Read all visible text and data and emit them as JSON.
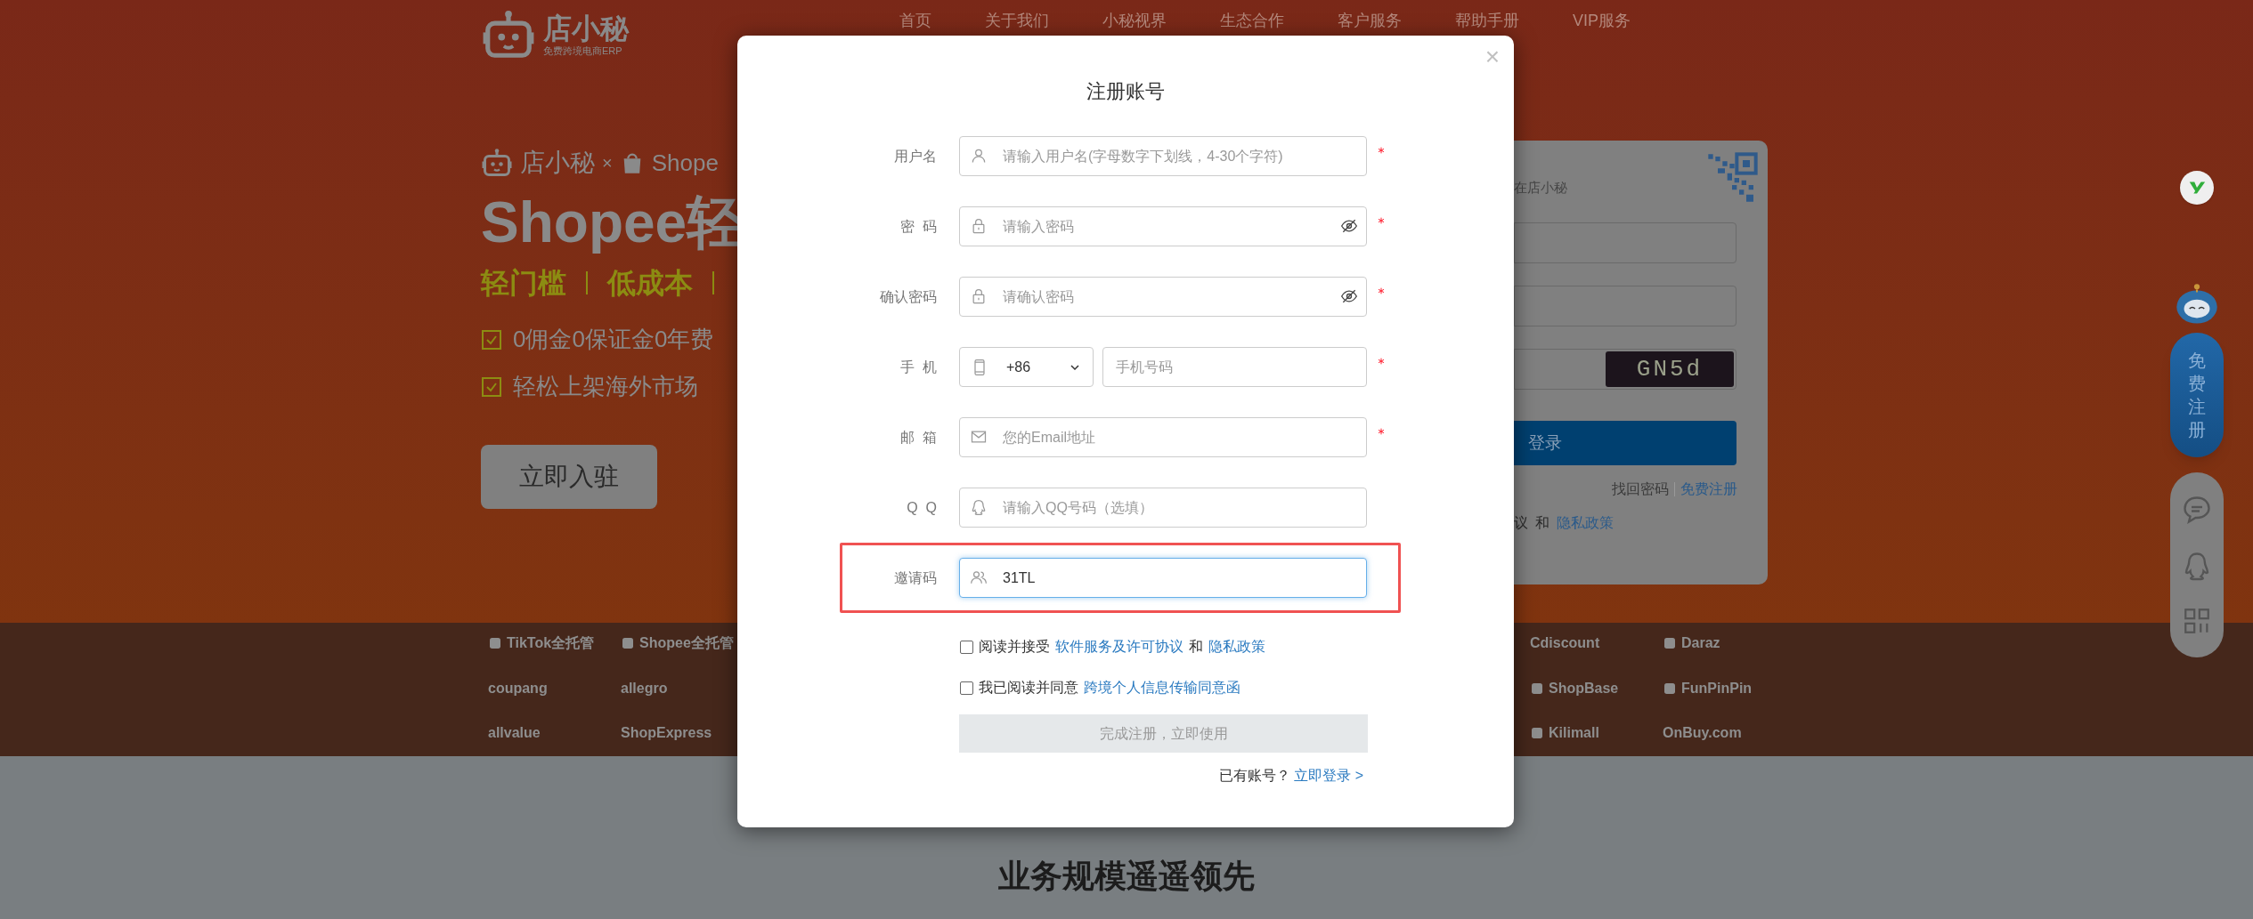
{
  "header": {
    "logo": {
      "name": "店小秘",
      "tagline": "免费跨境电商ERP"
    },
    "nav": [
      {
        "label": "首页"
      },
      {
        "label": "关于我们"
      },
      {
        "label": "小秘视界"
      },
      {
        "label": "生态合作"
      },
      {
        "label": "客户服务"
      },
      {
        "label": "帮助手册"
      },
      {
        "label": "VIP服务"
      }
    ]
  },
  "hero": {
    "brand_row": {
      "left": "店小秘",
      "separator": "×",
      "right": "Shope"
    },
    "headline": "Shopee轻",
    "tags": [
      "轻门槛",
      "低成本"
    ],
    "features": [
      {
        "text": "0佣金0保证金0年费",
        "checked": true
      },
      {
        "text": "轻松上架海外市场",
        "checked": true
      }
    ],
    "button": "立即入驻"
  },
  "login_card": {
    "tagline": "在店小秘",
    "captcha": "GN5d",
    "login_button": "登录",
    "links": [
      "找回密码",
      "免费注册"
    ],
    "agreement": [
      {
        "kind": "text",
        "text": "议"
      },
      {
        "kind": "text",
        "text": "和"
      },
      {
        "kind": "link",
        "text": "隐私政策"
      }
    ]
  },
  "floating": {
    "register": "免费注册"
  },
  "partner_logos": {
    "left": [
      {
        "name": "TikTok全托管",
        "icon": true
      },
      {
        "name": "Shopee全托管",
        "icon": true
      },
      {
        "name": "coupang",
        "icon": false
      },
      {
        "name": "allegro",
        "icon": false
      },
      {
        "name": "allvalue",
        "icon": false
      },
      {
        "name": "ShopExpress",
        "icon": false
      }
    ],
    "right": [
      {
        "name": "Cdiscount",
        "icon": false
      },
      {
        "name": "Daraz",
        "icon": true
      },
      {
        "name": "ShopBase",
        "icon": true
      },
      {
        "name": "FunPinPin",
        "icon": true
      },
      {
        "name": "Kilimall",
        "icon": true
      },
      {
        "name": "OnBuy.com",
        "icon": false
      }
    ]
  },
  "section_title": "业务规模遥遥领先",
  "modal": {
    "title": "注册账号",
    "close": "×",
    "fields": [
      {
        "kind": "user",
        "label": "用户名",
        "placeholder": "请输入用户名(字母数字下划线，4-30个字符)",
        "required": true,
        "password_toggle": false,
        "focused": false,
        "highlighted": false
      },
      {
        "kind": "password",
        "label": "密  码",
        "placeholder": "请输入密码",
        "required": true,
        "password_toggle": true,
        "focused": false,
        "highlighted": false
      },
      {
        "kind": "password",
        "label": "确认密码",
        "placeholder": "请确认密码",
        "required": true,
        "password_toggle": true,
        "focused": false,
        "highlighted": false
      },
      {
        "kind": "phone",
        "label": "手  机",
        "country_code": "+86",
        "placeholder": "手机号码",
        "required": true,
        "password_toggle": false,
        "focused": false,
        "highlighted": false
      },
      {
        "kind": "email",
        "label": "邮  箱",
        "placeholder": "您的Email地址",
        "required": true,
        "password_toggle": false,
        "focused": false,
        "highlighted": false
      },
      {
        "kind": "qq",
        "label": "Q  Q",
        "placeholder": "请输入QQ号码（选填）",
        "required": false,
        "password_toggle": false,
        "focused": false,
        "highlighted": false
      },
      {
        "kind": "invite",
        "label": "邀请码",
        "value": "31TL",
        "required": false,
        "password_toggle": false,
        "focused": true,
        "highlighted": true
      }
    ],
    "agreements": [
      {
        "checked": false,
        "parts": [
          {
            "kind": "text",
            "text": "阅读并接受"
          },
          {
            "kind": "link",
            "text": "软件服务及许可协议"
          },
          {
            "kind": "text",
            "text": "和"
          },
          {
            "kind": "link",
            "text": "隐私政策"
          }
        ]
      },
      {
        "checked": false,
        "parts": [
          {
            "kind": "text",
            "text": "我已阅读并同意"
          },
          {
            "kind": "link",
            "text": "跨境个人信息传输同意函"
          }
        ]
      }
    ],
    "submit": {
      "label": "完成注册，立即使用",
      "disabled": true
    },
    "login_prompt": {
      "text": "已有账号？",
      "link": "立即登录 >"
    }
  }
}
